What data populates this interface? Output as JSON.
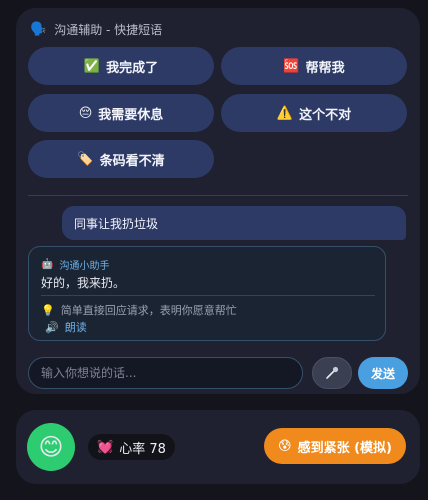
{
  "panel": {
    "title_icon": "speaking-head-icon",
    "title": "沟通辅助 - 快捷短语"
  },
  "quick_phrases": [
    {
      "icon": "check-mark-icon",
      "icon_glyph": "✅",
      "label": "我完成了"
    },
    {
      "icon": "sos-icon",
      "icon_glyph": "🆘",
      "label": "帮帮我"
    },
    {
      "icon": "tired-face-icon",
      "icon_glyph": "😔",
      "label": "我需要休息"
    },
    {
      "icon": "warning-icon",
      "icon_glyph": "⚠️",
      "label": "这个不对"
    },
    {
      "icon": "tag-icon",
      "icon_glyph": "🏷️",
      "label": "条码看不清"
    }
  ],
  "chat": {
    "user_message": "同事让我扔垃圾",
    "assistant": {
      "icon": "robot-icon",
      "icon_glyph": "🤖",
      "name": "沟通小助手",
      "reply": "好的，我来扔。",
      "hint_icon": "lightbulb-icon",
      "hint_icon_glyph": "💡",
      "hint": "简单直接回应请求，表明你愿意帮忙",
      "read_icon": "speaker-icon",
      "read_icon_glyph": "🔊",
      "read_label": "朗读"
    }
  },
  "composer": {
    "placeholder": "输入你想说的话...",
    "mic_icon": "microphone-icon",
    "send_label": "发送"
  },
  "status": {
    "avatar_glyph": "😊",
    "avatar_icon": "smiling-face-icon",
    "avatar_color": "#2ecc71",
    "heart_icon": "heart-icon",
    "heart_glyph": "💓",
    "heart_rate_label": "心率 78",
    "stress_button": {
      "icon": "anxious-face-icon",
      "icon_glyph": "😰",
      "label": "感到紧张 (模拟)",
      "color": "#f08a1c"
    }
  },
  "colors": {
    "background": "#14151c",
    "panel": "#1f2130",
    "quick_button": "#2d3a66",
    "accent_blue": "#4a9fe0",
    "assistant_name": "#6fb0e6"
  }
}
